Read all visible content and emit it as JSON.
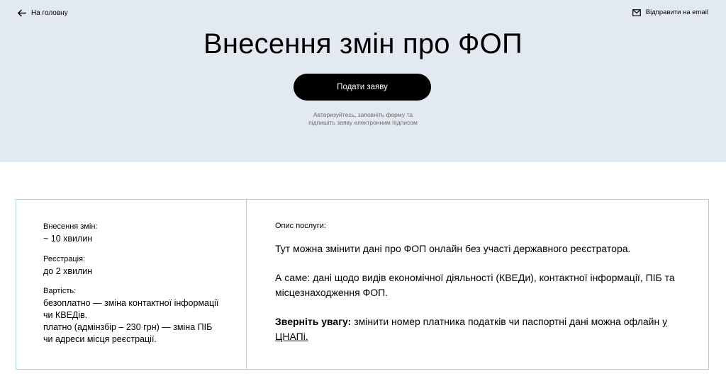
{
  "header": {
    "back_label": "На головну",
    "email_label": "Відправити на email"
  },
  "hero": {
    "title": "Внесення змін про ФОП",
    "submit_label": "Подати заяву",
    "hint_line1": "Авторизуйтесь, заповніть форму та",
    "hint_line2": "підпишіть заяву електронним підписом"
  },
  "info": {
    "changes_label": "Внесення змін:",
    "changes_value": "~ 10 хвилин",
    "registration_label": "Реєстрація:",
    "registration_value": "до 2 хвилин",
    "cost_label": "Вартість:",
    "cost_free": "безоплатно — зміна контактної інформації чи КВЕДів.",
    "cost_paid": "платно (адмінзбір – 230 грн) — зміна ПІБ чи адреси місця реєстрації."
  },
  "description": {
    "label": "Опис послуги:",
    "p1": "Тут можна змінити дані про ФОП онлайн без участі державного реєстратора.",
    "p2": "А саме: дані щодо видів економічної діяльності (КВЕДи), контактної інформації, ПІБ та місцезнаходження ФОП.",
    "p3_bold": "Зверніть увагу:",
    "p3_text": " змінити номер платника податків чи паспортні дані можна офлайн ",
    "p3_link": "у ЦНАПі."
  },
  "colors": {
    "hero_bg": "#e3e9f0",
    "card_border": "#9fd7d2",
    "button_bg": "#000000"
  },
  "icons": {
    "back": "arrow-left-icon",
    "email": "envelope-icon"
  }
}
